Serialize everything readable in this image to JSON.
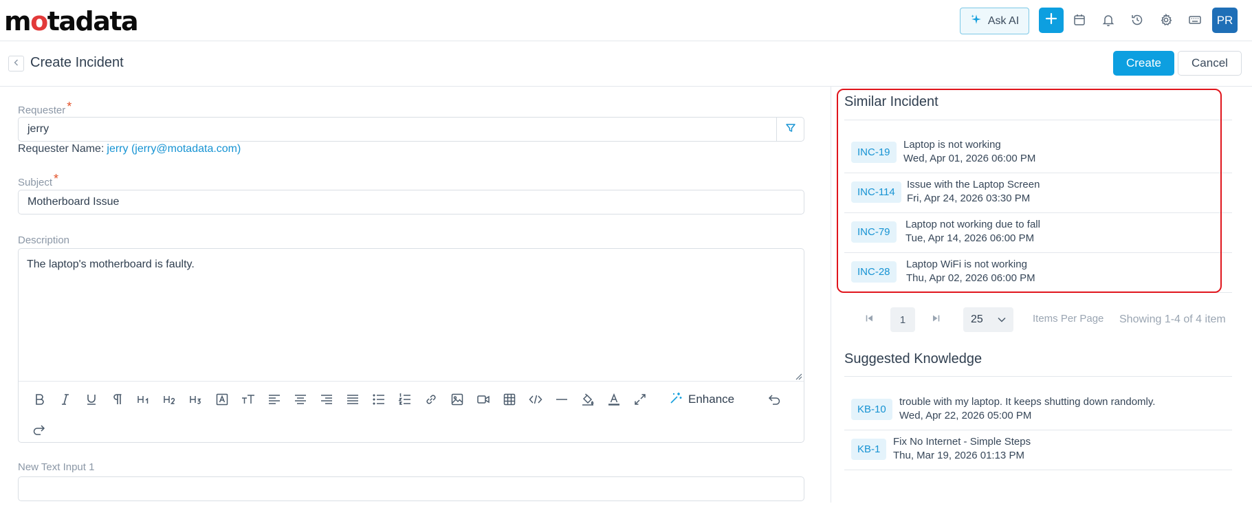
{
  "brand": {
    "logo_pre": "m",
    "logo_o": "o",
    "logo_post": "tadata"
  },
  "nav": {
    "ask_ai_label": "Ask AI",
    "avatar_initials": "PR",
    "icons": [
      "sparkle-icon",
      "plus-icon",
      "calendar-icon",
      "bell-icon",
      "history-icon",
      "gear-icon",
      "keyboard-icon"
    ]
  },
  "page": {
    "title": "Create Incident",
    "create_label": "Create",
    "cancel_label": "Cancel"
  },
  "form": {
    "requester_label": "Requester",
    "required_mark": "*",
    "requester_value": "jerry",
    "requester_name_label": "Requester Name:",
    "requester_name_value": "jerry (jerry@motadata.com)",
    "subject_label": "Subject",
    "subject_value": "Motherboard Issue",
    "description_label": "Description",
    "description_value": "The laptop's motherboard is faulty.",
    "enhance_label": "Enhance",
    "new_text_label": "New Text Input 1",
    "new_text_value": ""
  },
  "similar": {
    "title": "Similar Incident",
    "items": [
      {
        "id": "INC-19",
        "title": "Laptop is not working",
        "date": "Wed, Apr 01, 2026 06:00 PM"
      },
      {
        "id": "INC-114",
        "title": "Issue with the Laptop Screen",
        "date": "Fri, Apr 24, 2026 03:30 PM"
      },
      {
        "id": "INC-79",
        "title": "Laptop not working due to fall",
        "date": "Tue, Apr 14, 2026 06:00 PM"
      },
      {
        "id": "INC-28",
        "title": "Laptop WiFi is not working",
        "date": "Thu, Apr 02, 2026 06:00 PM"
      }
    ],
    "pagination": {
      "current_page": "1",
      "per_page": "25",
      "items_per_page_label": "Items Per Page",
      "showing_label": "Showing 1-4 of 4 item"
    }
  },
  "knowledge": {
    "title": "Suggested Knowledge",
    "items": [
      {
        "id": "KB-10",
        "title": "trouble with my laptop. It keeps shutting down randomly.",
        "date": "Wed, Apr 22, 2026 05:00 PM"
      },
      {
        "id": "KB-1",
        "title": "Fix No Internet - Simple Steps",
        "date": "Thu, Mar 19, 2026 01:13 PM"
      }
    ]
  },
  "colors": {
    "accent": "#0d9fe0",
    "link": "#1693d3",
    "highlight": "#e0151c",
    "required": "#e2522a"
  }
}
